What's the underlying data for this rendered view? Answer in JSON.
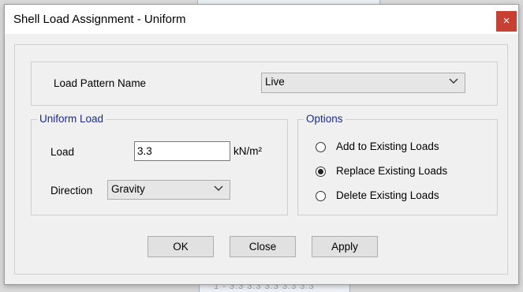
{
  "dialog": {
    "title": "Shell Load Assignment - Uniform",
    "close_glyph": "×"
  },
  "load_pattern": {
    "label": "Load Pattern Name",
    "selected": "Live"
  },
  "uniform_load": {
    "group_title": "Uniform Load",
    "load_label": "Load",
    "load_value": "3.3",
    "load_unit": "kN/m²",
    "direction_label": "Direction",
    "direction_selected": "Gravity"
  },
  "options": {
    "group_title": "Options",
    "items": [
      {
        "label": "Add to Existing Loads",
        "selected": false
      },
      {
        "label": "Replace Existing Loads",
        "selected": true
      },
      {
        "label": "Delete Existing Loads",
        "selected": false
      }
    ]
  },
  "buttons": {
    "ok": "OK",
    "close": "Close",
    "apply": "Apply"
  },
  "colors": {
    "close_button_bg": "#c84031",
    "group_title": "#1a2a9a"
  },
  "icons": {
    "close": "close-icon",
    "dropdown": "chevron-down-icon"
  },
  "background": {
    "bottom_strip_text": "1 - 3.3 3.3 3.3 3.3 3.3"
  }
}
